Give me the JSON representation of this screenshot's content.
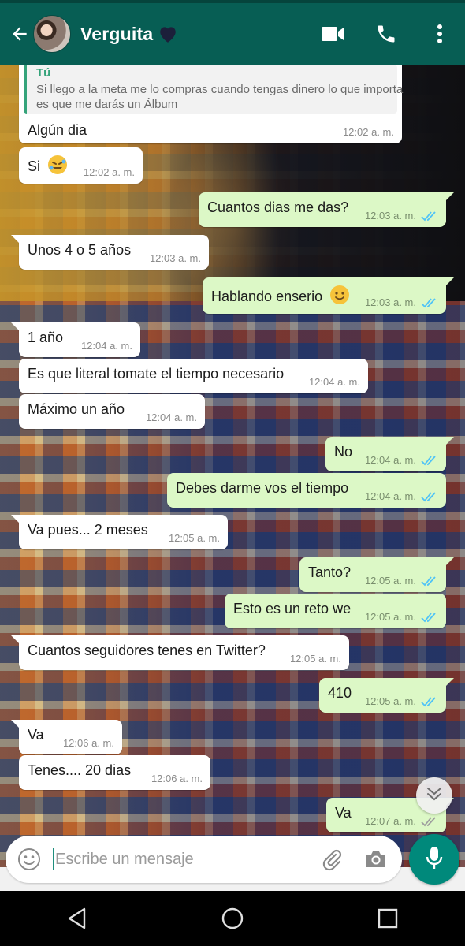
{
  "header": {
    "contact_name": "Verguita",
    "icons": [
      "back-arrow-icon",
      "avatar",
      "heart-icon",
      "video-call-icon",
      "phone-icon",
      "more-vert-icon"
    ],
    "brand_color": "#075e54"
  },
  "quote": {
    "author": "Tú",
    "text": "Si llego a la meta me lo compras cuando tengas dinero lo que importa es que me darás un Álbum"
  },
  "messages": [
    {
      "dir": "in",
      "text": "Algún dia",
      "time": "12:02 a. m."
    },
    {
      "dir": "in",
      "text": "Si",
      "emoji": "rolling-laughing-emoji",
      "time": "12:02 a. m."
    },
    {
      "dir": "out",
      "text": "Cuantos dias me das?",
      "time": "12:03 a. m.",
      "read": true
    },
    {
      "dir": "in",
      "text": "Unos 4 o 5 años",
      "time": "12:03 a. m."
    },
    {
      "dir": "out",
      "text": "Hablando enserio",
      "emoji": "smiling-face-emoji",
      "time": "12:03 a. m.",
      "read": true
    },
    {
      "dir": "in",
      "text": "1 año",
      "time": "12:04 a. m."
    },
    {
      "dir": "in",
      "text": "Es que literal tomate el tiempo necesario",
      "time": "12:04 a. m."
    },
    {
      "dir": "in",
      "text": "Máximo un año",
      "time": "12:04 a. m."
    },
    {
      "dir": "out",
      "text": "No",
      "time": "12:04 a. m.",
      "read": true
    },
    {
      "dir": "out",
      "text": "Debes darme vos el tiempo",
      "time": "12:04 a. m.",
      "read": true
    },
    {
      "dir": "in",
      "text": "Va pues... 2 meses",
      "time": "12:05 a. m."
    },
    {
      "dir": "out",
      "text": "Tanto?",
      "time": "12:05 a. m.",
      "read": true
    },
    {
      "dir": "out",
      "text": "Esto es un reto we",
      "time": "12:05 a. m.",
      "read": true
    },
    {
      "dir": "in",
      "text": "Cuantos seguidores tenes en Twitter?",
      "time": "12:05 a. m."
    },
    {
      "dir": "out",
      "text": "410",
      "time": "12:05 a. m.",
      "read": true
    },
    {
      "dir": "in",
      "text": "Va",
      "time": "12:06 a. m."
    },
    {
      "dir": "in",
      "text": "Tenes.... 20 dias",
      "time": "12:06 a. m."
    },
    {
      "dir": "out",
      "text": "Va",
      "time": "12:07 a. m.",
      "read": true
    }
  ],
  "input": {
    "placeholder": "Escribe un mensaje"
  },
  "colors": {
    "incoming_bubble": "#ffffff",
    "outgoing_bubble": "#dcf8c6",
    "read_ticks": "#4fc3f7",
    "mic_button": "#00897b"
  }
}
